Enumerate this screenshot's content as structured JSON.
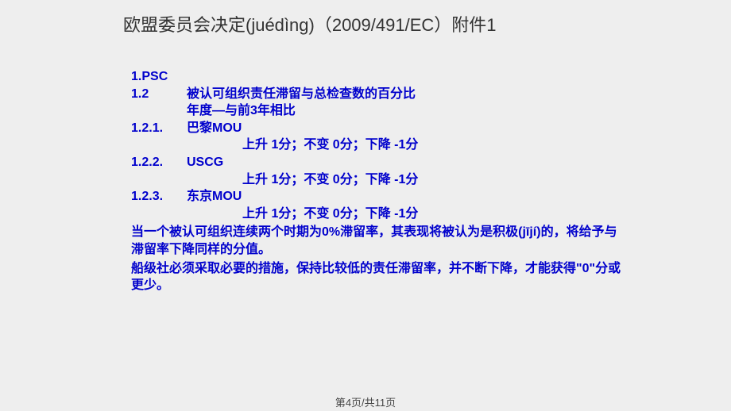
{
  "title": "欧盟委员会决定(juédìng)（2009/491/EC）附件1",
  "content": {
    "item1": "1.PSC",
    "item1_2_label": "1.2",
    "item1_2_text": "被认可组织责任滞留与总检查数的百分比",
    "item1_2_sub": "年度—与前3年相比",
    "item1_2_1_label": "1.2.1.",
    "item1_2_1_text": "巴黎MOU",
    "item1_2_1_scores": "上升   1分；不变   0分；下降   -1分",
    "item1_2_2_label": "1.2.2.",
    "item1_2_2_text": "USCG",
    "item1_2_2_scores": "上升   1分；不变   0分；下降   -1分",
    "item1_2_3_label": "1.2.3.",
    "item1_2_3_text": "东京MOU",
    "item1_2_3_scores": "上升   1分；不变   0分；下降   -1分",
    "para1": "当一个被认可组织连续两个时期为0%滞留率，其表现将被认为是积极(jījí)的，将给予与滞留率下降同样的分值。",
    "para2": "船级社必须采取必要的措施，保持比较低的责任滞留率，并不断下降，才能获得\"0\"分或更少。"
  },
  "footer": "第4页/共11页"
}
